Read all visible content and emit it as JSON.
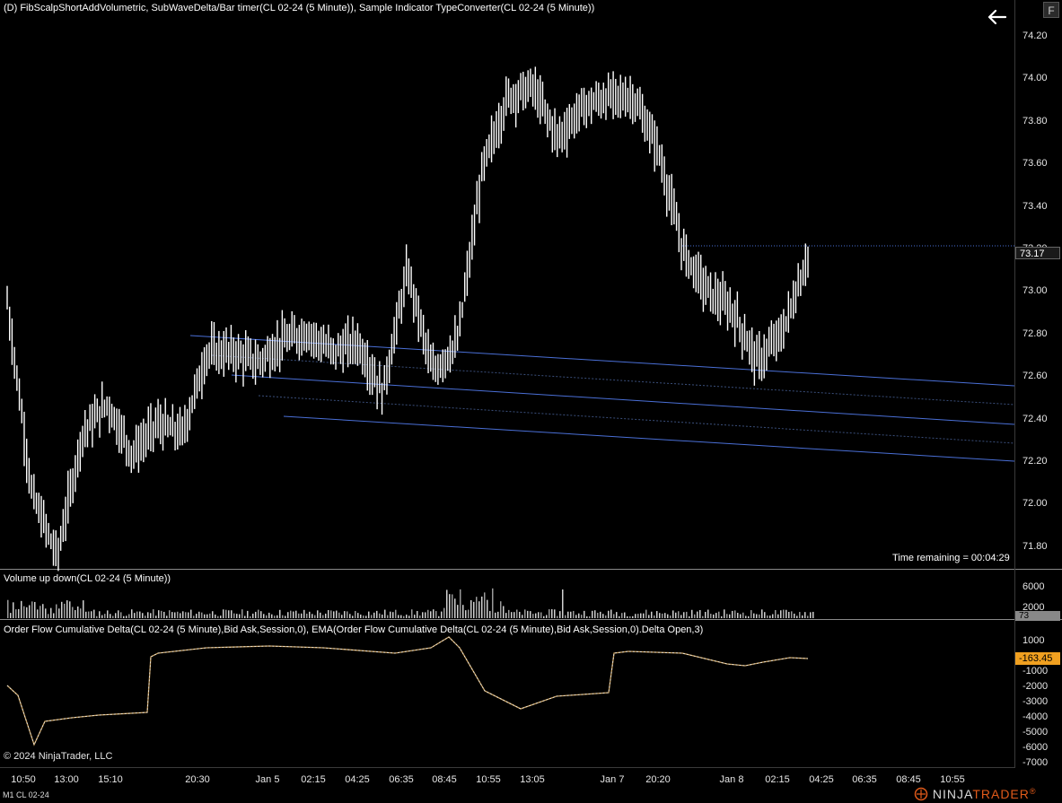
{
  "chart_header": {
    "title": "(D) FibScalpShortAddVolumetric, SubWaveDelta/Bar timer(CL 02-24 (5 Minute)), Sample Indicator TypeConverter(CL 02-24 (5 Minute))",
    "f_button": "F",
    "back_icon": "arrow-left-icon"
  },
  "price_panel": {
    "y_ticks": [
      "74.20",
      "74.00",
      "73.80",
      "73.60",
      "73.40",
      "73.20",
      "73.00",
      "72.80",
      "72.60",
      "72.40",
      "72.20",
      "72.00",
      "71.80"
    ],
    "last_price": "73.17",
    "time_remaining": "Time remaining = 00:04:29"
  },
  "volume_panel": {
    "title": "Volume up down(CL 02-24 (5 Minute))",
    "y_ticks": [
      "6000",
      "2000"
    ],
    "last_value": "73"
  },
  "delta_panel": {
    "title": "Order Flow Cumulative Delta(CL 02-24 (5 Minute),Bid Ask,Session,0), EMA(Order Flow Cumulative Delta(CL 02-24 (5 Minute),Bid Ask,Session,0).Delta Open,3)",
    "y_ticks": [
      "1000",
      "-1000",
      "-2000",
      "-3000",
      "-4000",
      "-5000",
      "-6000",
      "-7000"
    ],
    "last_value": "-163.45",
    "copyright": "© 2024 NinjaTrader, LLC"
  },
  "time_axis": {
    "labels": [
      "10:50",
      "13:00",
      "15:10",
      "20:30",
      "Jan 5",
      "02:15",
      "04:25",
      "06:35",
      "08:45",
      "10:55",
      "13:05",
      "Jan 7",
      "20:20",
      "Jan 8",
      "02:15",
      "04:25",
      "06:35",
      "08:45",
      "10:55"
    ]
  },
  "footer": {
    "instrument": "M1 CL 02-24",
    "logo_part1": "NINJA",
    "logo_part2": "TRADER",
    "logo_reg": "®"
  },
  "colors": {
    "background": "#000000",
    "candles": "#ffffff",
    "fib_lines": "#4a6fd6",
    "price_tag_bg": "#1a1a1a",
    "delta_tag_bg": "#f0a020",
    "ema_line": "#c8a060"
  },
  "chart_data": {
    "type": "line",
    "title": "",
    "series": [
      {
        "values": [
          72.95,
          72.0,
          71.7,
          72.3,
          72.45,
          72.2,
          72.35,
          72.3,
          72.7,
          72.7,
          72.65,
          72.75,
          72.8,
          72.7,
          72.75,
          72.5,
          73.1,
          72.6,
          72.75,
          73.6,
          73.95,
          74.0,
          73.75,
          73.9,
          73.95,
          73.95,
          73.7,
          73.2,
          73.0,
          72.9,
          72.65,
          72.8,
          73.17
        ]
      }
    ],
    "ylim": [
      71.7,
      74.25
    ]
  }
}
